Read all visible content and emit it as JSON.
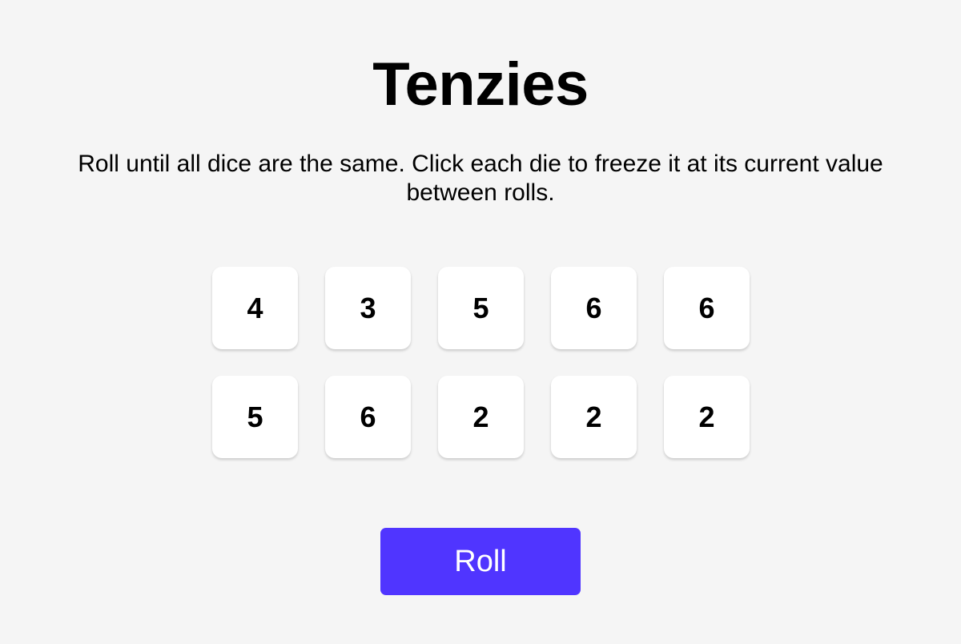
{
  "title": "Tenzies",
  "instructions": "Roll until all dice are the same. Click each die to freeze it at its current value between rolls.",
  "dice": [
    {
      "value": "4"
    },
    {
      "value": "3"
    },
    {
      "value": "5"
    },
    {
      "value": "6"
    },
    {
      "value": "6"
    },
    {
      "value": "5"
    },
    {
      "value": "6"
    },
    {
      "value": "2"
    },
    {
      "value": "2"
    },
    {
      "value": "2"
    }
  ],
  "roll_button": {
    "label": "Roll"
  },
  "colors": {
    "background": "#f5f5f5",
    "die_face": "#ffffff",
    "roll_button": "#5035ff"
  }
}
